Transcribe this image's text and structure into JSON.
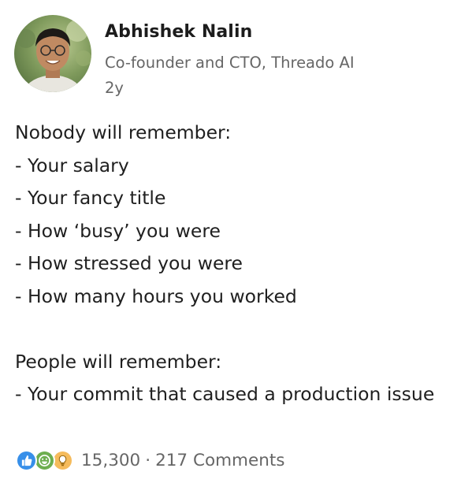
{
  "author": {
    "name": "Abhishek Nalin",
    "headline": "Co-founder and CTO, Threado AI",
    "age": "2y",
    "avatar_icon": "profile-photo"
  },
  "post": {
    "lines": [
      "Nobody will remember:",
      "- Your salary",
      "- Your fancy title",
      "- How ‘busy’ you were",
      "- How stressed you were",
      "- How many hours you worked",
      "",
      "People will remember:",
      "- Your commit that caused a production issue"
    ]
  },
  "social": {
    "reaction_icons": [
      "like-icon",
      "celebrate-icon",
      "insightful-icon"
    ],
    "reaction_count": "15,300",
    "separator": "·",
    "comments": "217 Comments"
  },
  "colors": {
    "like": "#378fe9",
    "celebrate": "#6dae4f",
    "insightful": "#f5bb5c",
    "secondary_text": "#666666"
  }
}
